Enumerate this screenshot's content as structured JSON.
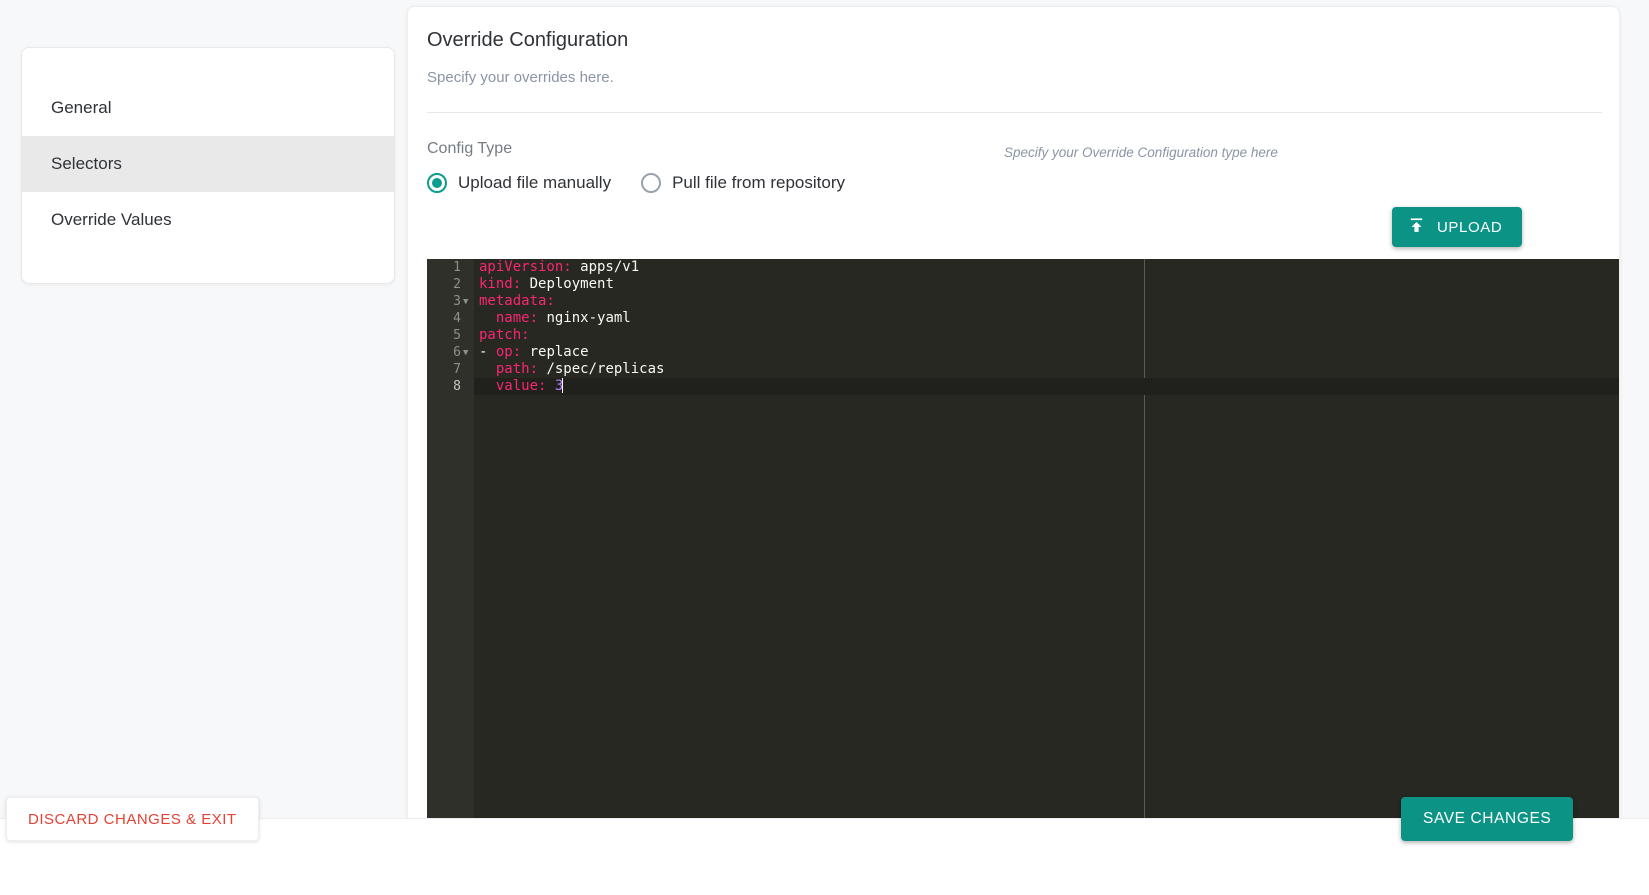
{
  "sidebar": {
    "items": [
      {
        "label": "General",
        "active": false
      },
      {
        "label": "Selectors",
        "active": true
      },
      {
        "label": "Override Values",
        "active": false
      }
    ]
  },
  "main": {
    "title": "Override Configuration",
    "subtitle": "Specify your overrides here.",
    "config_type_label": "Config Type",
    "hint": "Specify your Override Configuration type here",
    "radios": [
      {
        "label": "Upload file manually",
        "checked": true
      },
      {
        "label": "Pull file from repository",
        "checked": false
      }
    ],
    "upload_button": "UPLOAD",
    "upload_icon": "upload-icon"
  },
  "editor": {
    "language": "yaml",
    "cursor_line": 8,
    "lines": [
      {
        "n": 1,
        "fold": false,
        "tokens": [
          {
            "t": "apiVersion:",
            "c": "key"
          },
          {
            "t": " apps/v1",
            "c": "plain"
          }
        ]
      },
      {
        "n": 2,
        "fold": false,
        "tokens": [
          {
            "t": "kind:",
            "c": "key"
          },
          {
            "t": " Deployment",
            "c": "plain"
          }
        ]
      },
      {
        "n": 3,
        "fold": true,
        "tokens": [
          {
            "t": "metadata:",
            "c": "key"
          }
        ]
      },
      {
        "n": 4,
        "fold": false,
        "tokens": [
          {
            "t": "  name:",
            "c": "key"
          },
          {
            "t": " nginx-yaml",
            "c": "plain"
          }
        ]
      },
      {
        "n": 5,
        "fold": false,
        "tokens": [
          {
            "t": "patch:",
            "c": "key"
          }
        ]
      },
      {
        "n": 6,
        "fold": true,
        "tokens": [
          {
            "t": "- ",
            "c": "dash"
          },
          {
            "t": "op:",
            "c": "key"
          },
          {
            "t": " replace",
            "c": "plain"
          }
        ]
      },
      {
        "n": 7,
        "fold": false,
        "tokens": [
          {
            "t": "  path:",
            "c": "key"
          },
          {
            "t": " /spec/replicas",
            "c": "plain"
          }
        ]
      },
      {
        "n": 8,
        "fold": false,
        "tokens": [
          {
            "t": "  value:",
            "c": "key"
          },
          {
            "t": " ",
            "c": "plain"
          },
          {
            "t": "3",
            "c": "num"
          }
        ]
      }
    ]
  },
  "footer": {
    "discard_label": "DISCARD CHANGES & EXIT",
    "save_label": "SAVE CHANGES"
  },
  "colors": {
    "accent_teal": "#0b9386",
    "danger_red": "#e34234",
    "editor_bg": "#272822",
    "editor_key": "#f92672"
  }
}
